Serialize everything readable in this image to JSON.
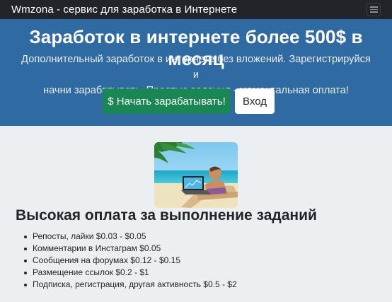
{
  "navbar": {
    "brand": "Wmzona - сервис для заработка в Интернете",
    "menu_icon": "hamburger-menu-icon"
  },
  "hero": {
    "title": "Заработок в интернете более 500$ в месяц",
    "subtitle_line1": "Дополнительный заработок в интернете без вложений. Зарегистрируйся и",
    "subtitle_line2": "начни зарабатывать. Простые задания - моментальная оплата!",
    "start_button": "$ Начать зарабатывать!",
    "login_button": "Вход"
  },
  "content": {
    "section_title": "Высокая оплата за выполнение заданий",
    "features": [
      "Репосты, лайки $0.03 - $0.05",
      "Комментарии в Инстаграм $0.05",
      "Сообщения на форумах $0.12 - $0.15",
      "Размещение ссылок $0.2 - $1",
      "Подписка, регистрация, другая активность $0.5 - $2"
    ]
  },
  "colors": {
    "navbar_bg": "#212529",
    "hero_bg": "#2f6aa3",
    "start_button_bg": "#198754",
    "page_bg": "#eceff1"
  }
}
